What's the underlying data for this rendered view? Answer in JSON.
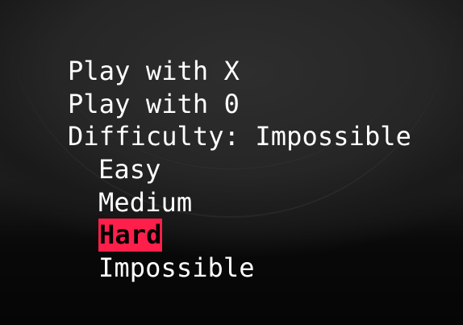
{
  "menu": {
    "play_x": "Play with X",
    "play_o": "Play with 0",
    "difficulty": "Difficulty: Impossible",
    "options": [
      "Easy",
      "Medium",
      "Hard",
      "Impossible"
    ],
    "selected": "Hard"
  },
  "colors": {
    "highlight": "#ff1f4b",
    "text": "#ffffff"
  }
}
